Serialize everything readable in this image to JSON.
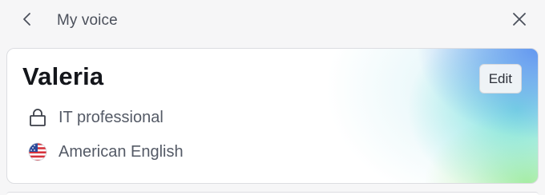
{
  "header": {
    "back_icon": "chevron-left-icon",
    "title": "My voice",
    "close_icon": "close-icon"
  },
  "voice_card": {
    "name": "Valeria",
    "edit_label": "Edit",
    "attributes": [
      {
        "icon": "lock-icon",
        "label": "IT professional"
      },
      {
        "icon": "us-flag-icon",
        "label": "American English"
      }
    ],
    "gradient_colors": [
      "#5c92f0",
      "#5aded6",
      "#a4ec8c"
    ]
  }
}
